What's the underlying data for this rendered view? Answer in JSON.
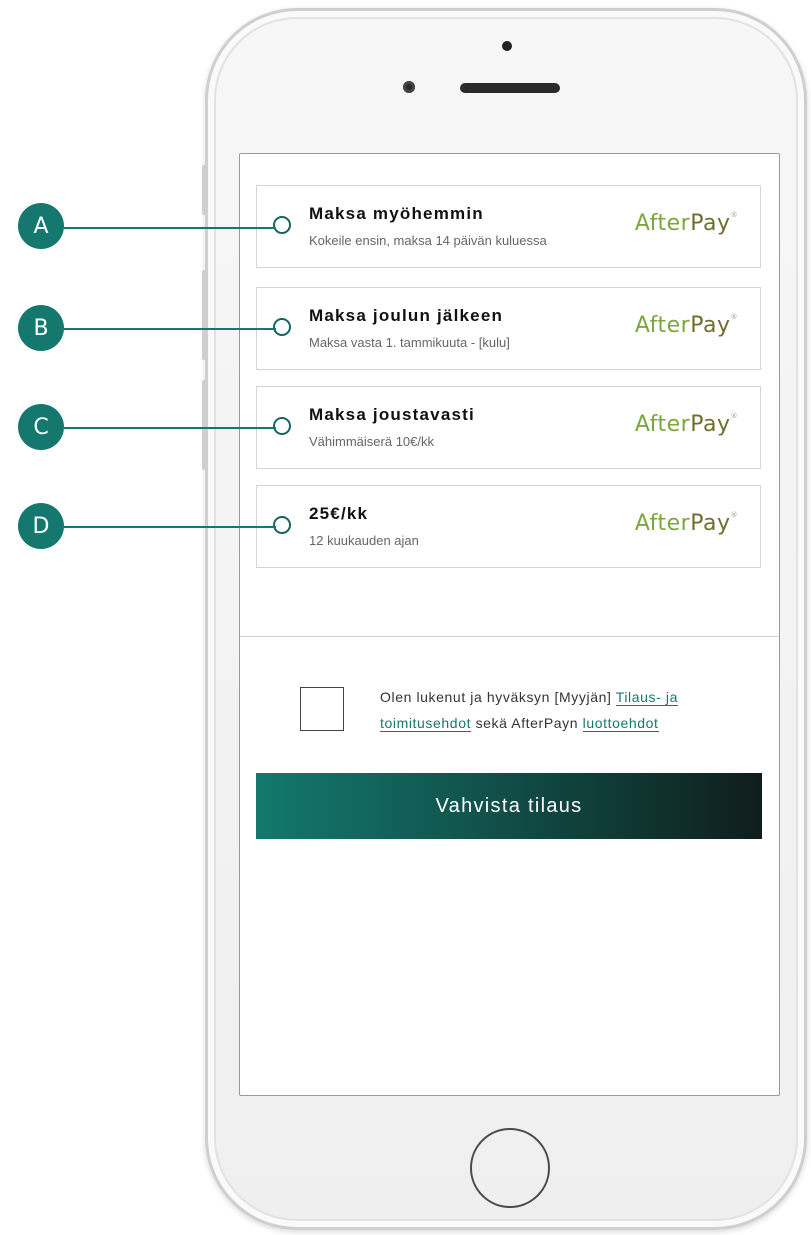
{
  "options": [
    {
      "key": "A",
      "title": "Maksa myöhemmin",
      "subtitle": "Kokeile ensin, maksa 14 päivän kuluessa",
      "brand_a": "After",
      "brand_b": "Pay",
      "brand_tm": "®"
    },
    {
      "key": "B",
      "title": "Maksa joulun jälkeen",
      "subtitle": "Maksa vasta 1. tammikuuta - [kulu]",
      "brand_a": "After",
      "brand_b": "Pay",
      "brand_tm": "®"
    },
    {
      "key": "C",
      "title": "Maksa joustavasti",
      "subtitle": "Vähimmäiserä 10€/kk",
      "brand_a": "After",
      "brand_b": "Pay",
      "brand_tm": "®"
    },
    {
      "key": "D",
      "title": "25€/kk",
      "subtitle": "12 kuukauden ajan",
      "brand_a": "After",
      "brand_b": "Pay",
      "brand_tm": "®"
    }
  ],
  "terms": {
    "text_1": "Olen lukenut ja hyväksyn [Myyjän] ",
    "link_1": "Tilaus- ja toimitusehdot",
    "text_2": " sekä AfterPayn ",
    "link_2": "luottoehdot"
  },
  "cta_label": "Vahvista tilaus",
  "colors": {
    "accent": "#14786f",
    "brand_green": "#7da63d",
    "brand_dark": "#6e6e2f"
  }
}
